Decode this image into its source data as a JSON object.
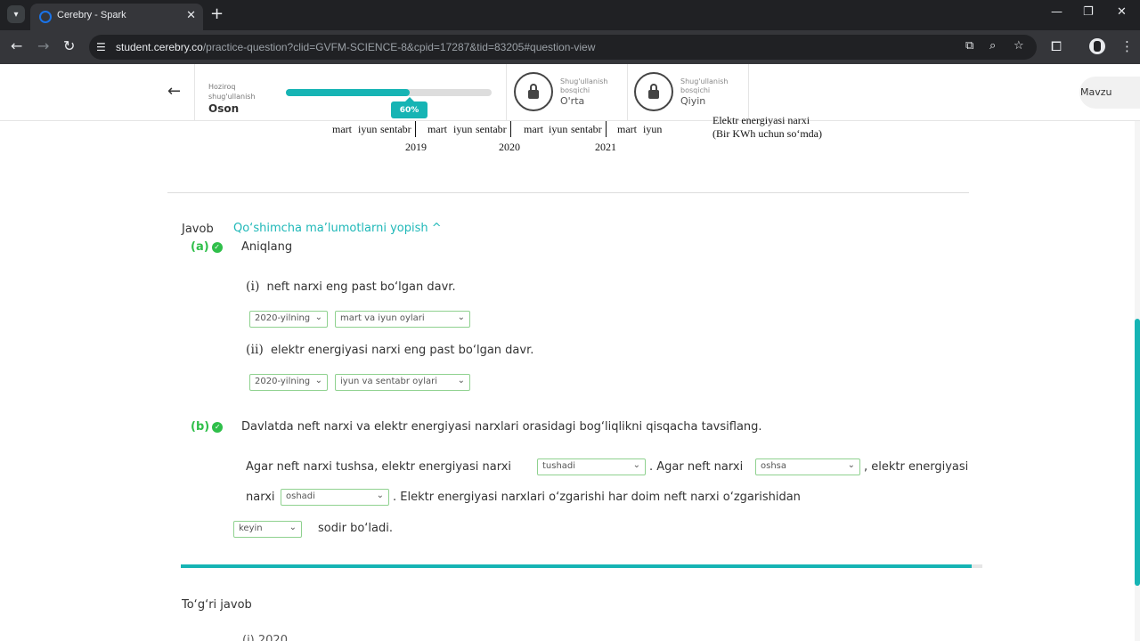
{
  "browser": {
    "tab_title": "Cerebry - Spark",
    "url_host": "student.cerebry.co",
    "url_path": "/practice-question?clid=GVFM-SCIENCE-8&cpid=17287&tid=83205#question-view"
  },
  "practice_header": {
    "current_label": "Hoziroq shug'ullanish",
    "current_level": "Oson",
    "progress_percent": 60,
    "progress_label": "60%",
    "levels": [
      {
        "label": "Shug'ullanish bosqichi",
        "name": "O'rta"
      },
      {
        "label": "Shug'ullanish bosqichi",
        "name": "Qiyin"
      }
    ],
    "topic_button": "Mavzu"
  },
  "chart_fragment": {
    "month_labels": [
      "mart",
      "iyun",
      "sentabr",
      "mart",
      "iyun",
      "sentabr",
      "mart",
      "iyun",
      "sentabr",
      "mart",
      "iyun"
    ],
    "years": [
      "2019",
      "2020",
      "2021"
    ],
    "legend_partial": "Elektr energiyasi narxi",
    "legend_unit": "(Bir KWh uchun so‘mda)"
  },
  "answer": {
    "heading": "Javob",
    "toggle_link": "Qo‘shimcha ma’lumotlarni yopish ^",
    "part_a": {
      "label": "(a)",
      "instruction": "Aniqlang",
      "q1_num": "(i)",
      "q1_text": "neft narxi eng past bo‘lgan davr.",
      "q1_year": "2020-yilning",
      "q1_months": "mart va iyun oylari",
      "q2_num": "(ii)",
      "q2_text": "elektr energiyasi narxi eng past bo‘lgan davr.",
      "q2_year": "2020-yilning",
      "q2_months": "iyun va sentabr oylari"
    },
    "part_b": {
      "label": "(b)",
      "prompt": "Davlatda neft narxi va elektr energiyasi narxlari orasidagi bog‘liqlikni qisqacha tavsiflang.",
      "s1": "Agar neft narxi tushsa, elektr energiyasi narxi",
      "d1": "tushadi",
      "s2": ". Agar neft narxi",
      "d2": "oshsa",
      "s3": ", elektr energiyasi",
      "s4": "narxi",
      "d3": "oshadi",
      "s5": ". Elektr energiyasi narxlari o‘zgarishi har doim neft narxi o‘zgarishidan",
      "d4": "keyin",
      "s6": "sodir bo‘ladi."
    },
    "correct_heading": "To‘g‘ri javob",
    "next_partial": "(i)   2020"
  }
}
